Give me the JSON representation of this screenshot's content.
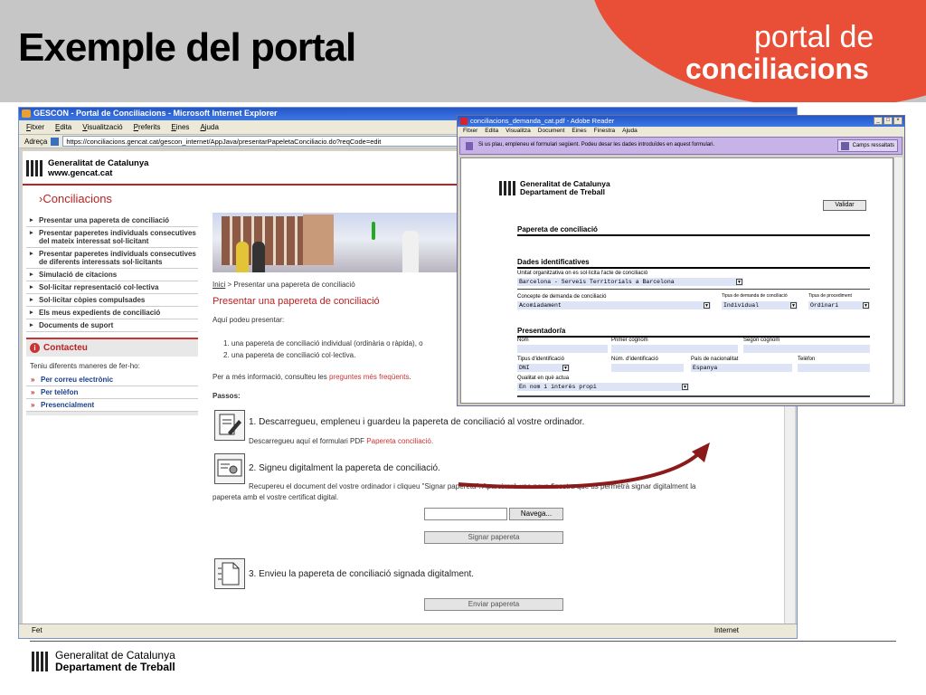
{
  "slide": {
    "title": "Exemple del portal",
    "brand_line1": "portal de",
    "brand_line2": "conciliacions",
    "footer_line1": "Generalitat de Catalunya",
    "footer_line2": "Departament de Treball"
  },
  "ie": {
    "title": "GESCON - Portal de Conciliacions - Microsoft Internet Explorer",
    "menu": [
      "Fitxer",
      "Edita",
      "Visualització",
      "Preferits",
      "Eines",
      "Ajuda"
    ],
    "address_label": "Adreça",
    "address": "https://conciliacions.gencat.cat/gescon_internet/AppJava/presentarPapeletaConciliacio.do?reqCode=edit",
    "status_left": "Fet",
    "status_right": "Internet",
    "logo_line1": "Generalitat de Catalunya",
    "logo_line2": "www.gencat.cat",
    "section_title": "Conciliacions",
    "sidebar_items": [
      "Presentar una papereta de conciliació",
      "Presentar paperetes individuals consecutives del mateix interessat sol·licitant",
      "Presentar paperetes individuals consecutives de diferents interessats sol·licitants",
      "Simulació de citacions",
      "Sol·licitar representació col·lectiva",
      "Sol·licitar còpies compulsades",
      "Els meus expedients de conciliació",
      "Documents de suport"
    ],
    "contact_title": "Contacteu",
    "contact_sub": "Teniu diferents maneres de fer-ho:",
    "contact_links": [
      "Per correu electrònic",
      "Per telèfon",
      "Presencialment"
    ],
    "breadcrumb_home": "Inici",
    "breadcrumb_rest": " > Presentar una papereta de conciliació",
    "heading": "Presentar una papereta de conciliació",
    "intro": "Aquí podeu presentar:",
    "list1": "1.   una papereta de conciliació individual (ordinària o ràpida), o",
    "list2": "2.   una papereta de conciliació col·lectiva.",
    "more_info": "Per a més informació, consulteu les ",
    "faq_link": "preguntes més freqüents",
    "faq_end": ".",
    "steps_label": "Passos:",
    "step1_title": "1. Descarregueu, empleneu i guardeu la papereta de conciliació al vostre ordinador.",
    "step1_sub": "Descarregueu aquí el formulari PDF ",
    "step1_link": "Papereta conciliació.",
    "step2_title": "2. Signeu digitalment la papereta de conciliació.",
    "step2_sub1": "Recupereu el document del vostre ordinador i cliqueu \"Signar papereta\". Apareixerà una nova finestra que us permetrà signar digitalment la",
    "step2_sub2": "papereta amb el vostre certificat digital.",
    "browse_btn": "Navega...",
    "sign_btn": "Signar papereta",
    "step3_title": "3. Envieu la papereta de conciliació signada digitalment.",
    "send_btn": "Enviar papereta"
  },
  "pdf": {
    "title": "conciliacions_demanda_cat.pdf - Adobe Reader",
    "menu": [
      "Fitxer",
      "Edita",
      "Visualitza",
      "Document",
      "Eines",
      "Finestra",
      "Ajuda"
    ],
    "message": "Si us plau, empleneu el formulari següent. Podeu desar les dades introduïdes en aquest formulari.",
    "camps_btn": "Camps ressaltats",
    "logo_line1": "Generalitat de Catalunya",
    "logo_line2": "Departament de Treball",
    "validar": "Validar",
    "form_title": "Papereta de conciliació",
    "sec_dades": "Dades identificatives",
    "lbl_unitat": "Unitat organitzativa on es sol·licita l'acte de conciliació",
    "val_unitat": "Barcelona - Serveis Territorials a Barcelona",
    "lbl_concepte": "Concepte de demanda de conciliació",
    "val_concepte": "Acomiadament",
    "lbl_tipus_demanda": "Tipus de demanda de conciliació",
    "val_tipus_demanda": "Individual",
    "lbl_tipus_proc": "Tipus de procediment",
    "val_tipus_proc": "Ordinari",
    "sec_presentador": "Presentador/a",
    "lbl_nom": "Nom",
    "lbl_primer": "Primer cognom",
    "lbl_segon": "Segon cognom",
    "lbl_tipus_id": "Tipus d'identificació",
    "val_tipus_id": "DNI",
    "lbl_num_id": "Núm. d'identificació",
    "lbl_pais": "País de nacionalitat",
    "val_pais": "Espanya",
    "lbl_telefon": "Telèfon",
    "lbl_qualitat": "Qualitat en què actua",
    "val_qualitat": "En nom i interès propi"
  }
}
